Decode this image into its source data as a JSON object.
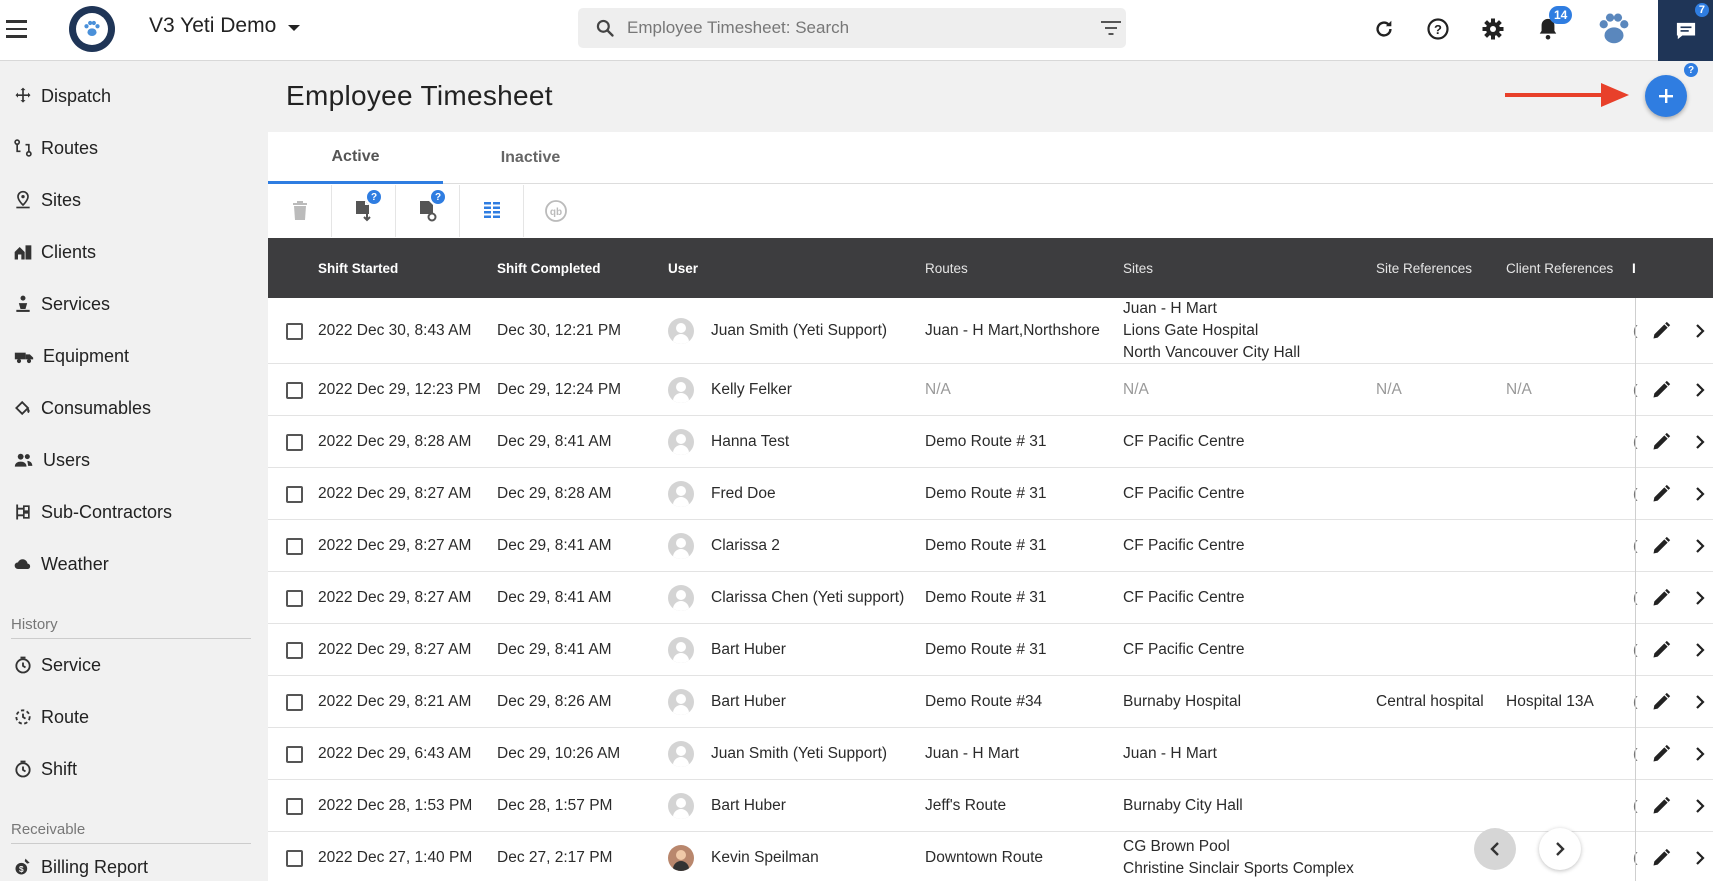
{
  "app": {
    "title": "V3 Yeti Demo",
    "search_placeholder": "Employee Timesheet: Search",
    "notifications_count": "14",
    "chat_count": "7"
  },
  "sidebar": {
    "items": [
      {
        "label": "Dispatch",
        "icon": "dispatch-icon"
      },
      {
        "label": "Routes",
        "icon": "routes-icon"
      },
      {
        "label": "Sites",
        "icon": "sites-icon"
      },
      {
        "label": "Clients",
        "icon": "clients-icon"
      },
      {
        "label": "Services",
        "icon": "services-icon"
      },
      {
        "label": "Equipment",
        "icon": "equipment-icon"
      },
      {
        "label": "Consumables",
        "icon": "consumables-icon"
      },
      {
        "label": "Users",
        "icon": "users-icon"
      },
      {
        "label": "Sub-Contractors",
        "icon": "sub-contractors-icon"
      },
      {
        "label": "Weather",
        "icon": "weather-icon"
      }
    ],
    "history_label": "History",
    "history_items": [
      {
        "label": "Service",
        "icon": "history-service-icon"
      },
      {
        "label": "Route",
        "icon": "history-route-icon"
      },
      {
        "label": "Shift",
        "icon": "history-shift-icon"
      }
    ],
    "receivable_label": "Receivable",
    "receivable_items": [
      {
        "label": "Billing Report",
        "icon": "billing-report-icon"
      }
    ]
  },
  "page": {
    "title": "Employee Timesheet",
    "fab_help": "?",
    "tabs": [
      {
        "label": "Active",
        "active": true
      },
      {
        "label": "Inactive",
        "active": false
      }
    ]
  },
  "table": {
    "columns": [
      "Shift Started",
      "Shift Completed",
      "User",
      "Routes",
      "Sites",
      "Site References",
      "Client References"
    ],
    "rows": [
      {
        "started": "2022 Dec 30, 8:43 AM",
        "completed": "Dec 30, 12:21 PM",
        "user": "Juan Smith (Yeti Support)",
        "routes": "Juan - H Mart,Northshore",
        "sites": [
          "Juan - H Mart",
          "Lions Gate Hospital",
          "North Vancouver City Hall"
        ],
        "site_ref": "",
        "client_ref": ""
      },
      {
        "started": "2022 Dec 29, 12:23 PM",
        "completed": "Dec 29, 12:24 PM",
        "user": "Kelly Felker",
        "routes": "N/A",
        "sites": [
          "N/A"
        ],
        "site_ref": "N/A",
        "client_ref": "N/A"
      },
      {
        "started": "2022 Dec 29, 8:28 AM",
        "completed": "Dec 29, 8:41 AM",
        "user": "Hanna Test",
        "routes": "Demo Route # 31",
        "sites": [
          "CF Pacific Centre"
        ],
        "site_ref": "",
        "client_ref": ""
      },
      {
        "started": "2022 Dec 29, 8:27 AM",
        "completed": "Dec 29, 8:28 AM",
        "user": "Fred Doe",
        "routes": "Demo Route # 31",
        "sites": [
          "CF Pacific Centre"
        ],
        "site_ref": "",
        "client_ref": ""
      },
      {
        "started": "2022 Dec 29, 8:27 AM",
        "completed": "Dec 29, 8:41 AM",
        "user": "Clarissa 2",
        "routes": "Demo Route # 31",
        "sites": [
          "CF Pacific Centre"
        ],
        "site_ref": "",
        "client_ref": ""
      },
      {
        "started": "2022 Dec 29, 8:27 AM",
        "completed": "Dec 29, 8:41 AM",
        "user": "Clarissa Chen (Yeti support)",
        "routes": "Demo Route # 31",
        "sites": [
          "CF Pacific Centre"
        ],
        "site_ref": "",
        "client_ref": ""
      },
      {
        "started": "2022 Dec 29, 8:27 AM",
        "completed": "Dec 29, 8:41 AM",
        "user": "Bart Huber",
        "routes": "Demo Route # 31",
        "sites": [
          "CF Pacific Centre"
        ],
        "site_ref": "",
        "client_ref": ""
      },
      {
        "started": "2022 Dec 29, 8:21 AM",
        "completed": "Dec 29, 8:26 AM",
        "user": "Bart Huber",
        "routes": "Demo Route #34",
        "sites": [
          "Burnaby Hospital"
        ],
        "site_ref": "Central hospital",
        "client_ref": "Hospital 13A"
      },
      {
        "started": "2022 Dec 29, 6:43 AM",
        "completed": "Dec 29, 10:26 AM",
        "user": "Juan Smith (Yeti Support)",
        "routes": "Juan - H Mart",
        "sites": [
          "Juan - H Mart"
        ],
        "site_ref": "",
        "client_ref": ""
      },
      {
        "started": "2022 Dec 28, 1:53 PM",
        "completed": "Dec 28, 1:57 PM",
        "user": "Bart Huber",
        "routes": "Jeff's Route",
        "sites": [
          "Burnaby City Hall"
        ],
        "site_ref": "",
        "client_ref": ""
      },
      {
        "started": "2022 Dec 27, 1:40 PM",
        "completed": "Dec 27, 2:17 PM",
        "user": "Kevin Speilman",
        "routes": "Downtown Route",
        "sites": [
          "CG Brown Pool",
          "Christine Sinclair Sports Complex"
        ],
        "site_ref": "",
        "client_ref": ""
      }
    ]
  },
  "colors": {
    "accent": "#2f7de1",
    "header_bg": "#3d3d3f",
    "navy": "#1f3557",
    "arrow": "#e8402a"
  }
}
